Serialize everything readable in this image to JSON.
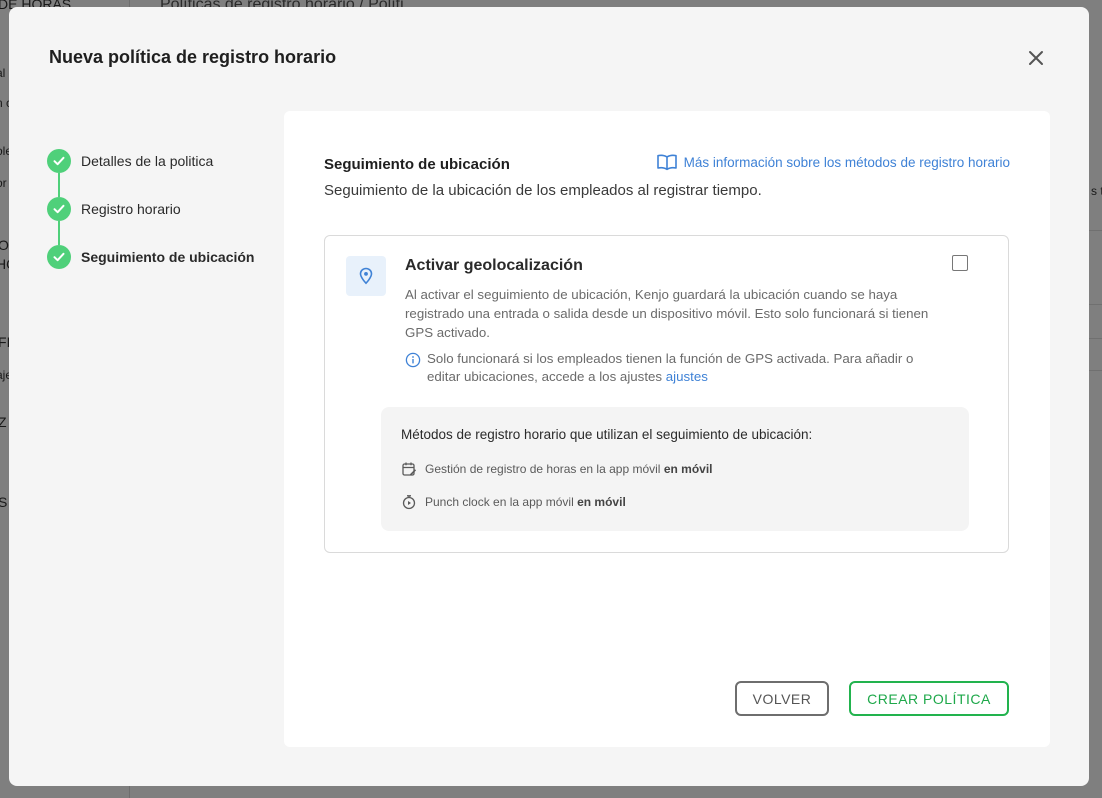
{
  "background": {
    "breadcrumb": "Políticas de registro horario / Políti",
    "sidebar_fragments": [
      "DE HORAS",
      "al",
      "n c",
      "ole",
      "or",
      "O",
      "HO",
      "FI",
      "aje",
      "Z",
      "S"
    ],
    "right_fragment": "s t"
  },
  "modal": {
    "title": "Nueva política de registro horario",
    "close_icon": "close-icon"
  },
  "stepper": {
    "steps": [
      {
        "label": "Detalles de la politica",
        "done": true
      },
      {
        "label": "Registro horario",
        "done": true
      },
      {
        "label": "Seguimiento de ubicación",
        "done": true,
        "active": true
      }
    ]
  },
  "section": {
    "title": "Seguimiento de ubicación",
    "subtitle": "Seguimiento de la ubicación de los empleados al registrar tiempo.",
    "info_link": "Más información sobre los métodos de registro horario"
  },
  "geolocation": {
    "title": "Activar geolocalización",
    "checked": false,
    "description": "Al activar el seguimiento de ubicación, Kenjo guardará la ubicación cuando se haya registrado una entrada o salida desde un dispositivo móvil. Esto solo funcionará si tienen GPS activado.",
    "note": "Solo funcionará si los empleados tienen la función de GPS activada. Para añadir o editar ubicaciones, accede a los ajustes",
    "note_link": "ajustes",
    "methods_title": "Métodos de registro horario que utilizan el seguimiento de ubicación:",
    "methods": [
      {
        "label": "Gestión de registro de horas en la app móvil",
        "tag": "en móvil",
        "icon": "calendar-edit-icon"
      },
      {
        "label": "Punch clock en la app móvil",
        "tag": "en móvil",
        "icon": "stopwatch-icon"
      }
    ]
  },
  "buttons": {
    "back": "VOLVER",
    "create": "CREAR POLÍTICA"
  },
  "colors": {
    "accent_green": "#22b34e",
    "step_green": "#4fd07a",
    "link_blue": "#3f82d6"
  }
}
